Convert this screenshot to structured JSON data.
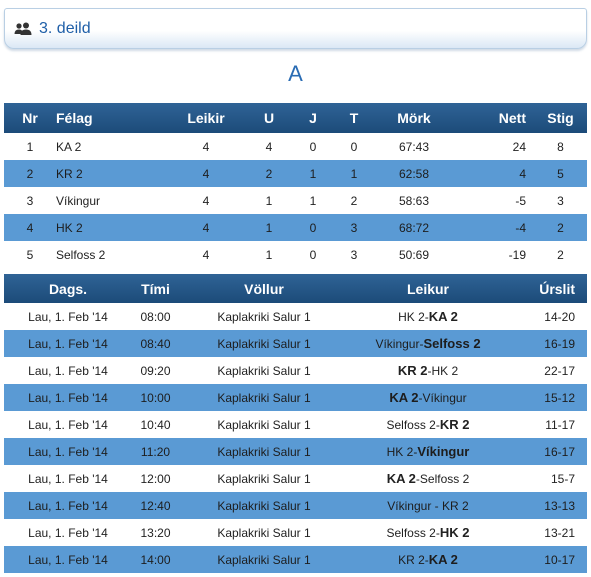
{
  "header": {
    "title": "3. deild",
    "icon": "group-icon"
  },
  "group": "A",
  "standings": {
    "columns": [
      "Nr",
      "Félag",
      "Leikir",
      "U",
      "J",
      "T",
      "Mörk",
      "Nett",
      "Stig"
    ],
    "rows": [
      [
        "1",
        "KA 2",
        "4",
        "4",
        "0",
        "0",
        "67:43",
        "24",
        "8"
      ],
      [
        "2",
        "KR 2",
        "4",
        "2",
        "1",
        "1",
        "62:58",
        "4",
        "5"
      ],
      [
        "3",
        "Víkingur",
        "4",
        "1",
        "1",
        "2",
        "58:63",
        "-5",
        "3"
      ],
      [
        "4",
        "HK 2",
        "4",
        "1",
        "0",
        "3",
        "68:72",
        "-4",
        "2"
      ],
      [
        "5",
        "Selfoss 2",
        "4",
        "1",
        "0",
        "3",
        "50:69",
        "-19",
        "2"
      ]
    ]
  },
  "matches": {
    "columns": [
      "Dags.",
      "Tími",
      "Völlur",
      "Leikur",
      "Úrslit"
    ],
    "rows": [
      {
        "date": "Lau, 1. Feb '14",
        "time": "08:00",
        "venue": "Kaplakriki Salur 1",
        "home": "HK 2",
        "sep": "-",
        "away": "KA 2",
        "winner": "away",
        "result": "14-20"
      },
      {
        "date": "Lau, 1. Feb '14",
        "time": "08:40",
        "venue": "Kaplakriki Salur 1",
        "home": "Víkingur",
        "sep": "-",
        "away": "Selfoss 2",
        "winner": "away",
        "result": "16-19"
      },
      {
        "date": "Lau, 1. Feb '14",
        "time": "09:20",
        "venue": "Kaplakriki Salur 1",
        "home": "KR 2",
        "sep": "-",
        "away": "HK 2",
        "winner": "home",
        "result": "22-17"
      },
      {
        "date": "Lau, 1. Feb '14",
        "time": "10:00",
        "venue": "Kaplakriki Salur 1",
        "home": "KA 2",
        "sep": "-",
        "away": "Víkingur",
        "winner": "home",
        "result": "15-12"
      },
      {
        "date": "Lau, 1. Feb '14",
        "time": "10:40",
        "venue": "Kaplakriki Salur 1",
        "home": "Selfoss 2",
        "sep": "-",
        "away": "KR 2",
        "winner": "away",
        "result": "11-17"
      },
      {
        "date": "Lau, 1. Feb '14",
        "time": "11:20",
        "venue": "Kaplakriki Salur 1",
        "home": "HK 2",
        "sep": "-",
        "away": "Víkingur",
        "winner": "away",
        "result": "16-17"
      },
      {
        "date": "Lau, 1. Feb '14",
        "time": "12:00",
        "venue": "Kaplakriki Salur 1",
        "home": "KA 2",
        "sep": "-",
        "away": "Selfoss 2",
        "winner": "home",
        "result": "15-7"
      },
      {
        "date": "Lau, 1. Feb '14",
        "time": "12:40",
        "venue": "Kaplakriki Salur 1",
        "home": "Víkingur",
        "sep": " - ",
        "away": "KR 2",
        "winner": "none",
        "result": "13-13"
      },
      {
        "date": "Lau, 1. Feb '14",
        "time": "13:20",
        "venue": "Kaplakriki Salur 1",
        "home": "Selfoss 2",
        "sep": "-",
        "away": "HK 2",
        "winner": "away",
        "result": "13-21"
      },
      {
        "date": "Lau, 1. Feb '14",
        "time": "14:00",
        "venue": "Kaplakriki Salur 1",
        "home": "KR 2",
        "sep": "-",
        "away": "KA 2",
        "winner": "away",
        "result": "10-17"
      }
    ]
  },
  "colors": {
    "header_bar": "#1c4b79",
    "row_alt": "#5a9ad4",
    "title": "#1f5fa8"
  }
}
